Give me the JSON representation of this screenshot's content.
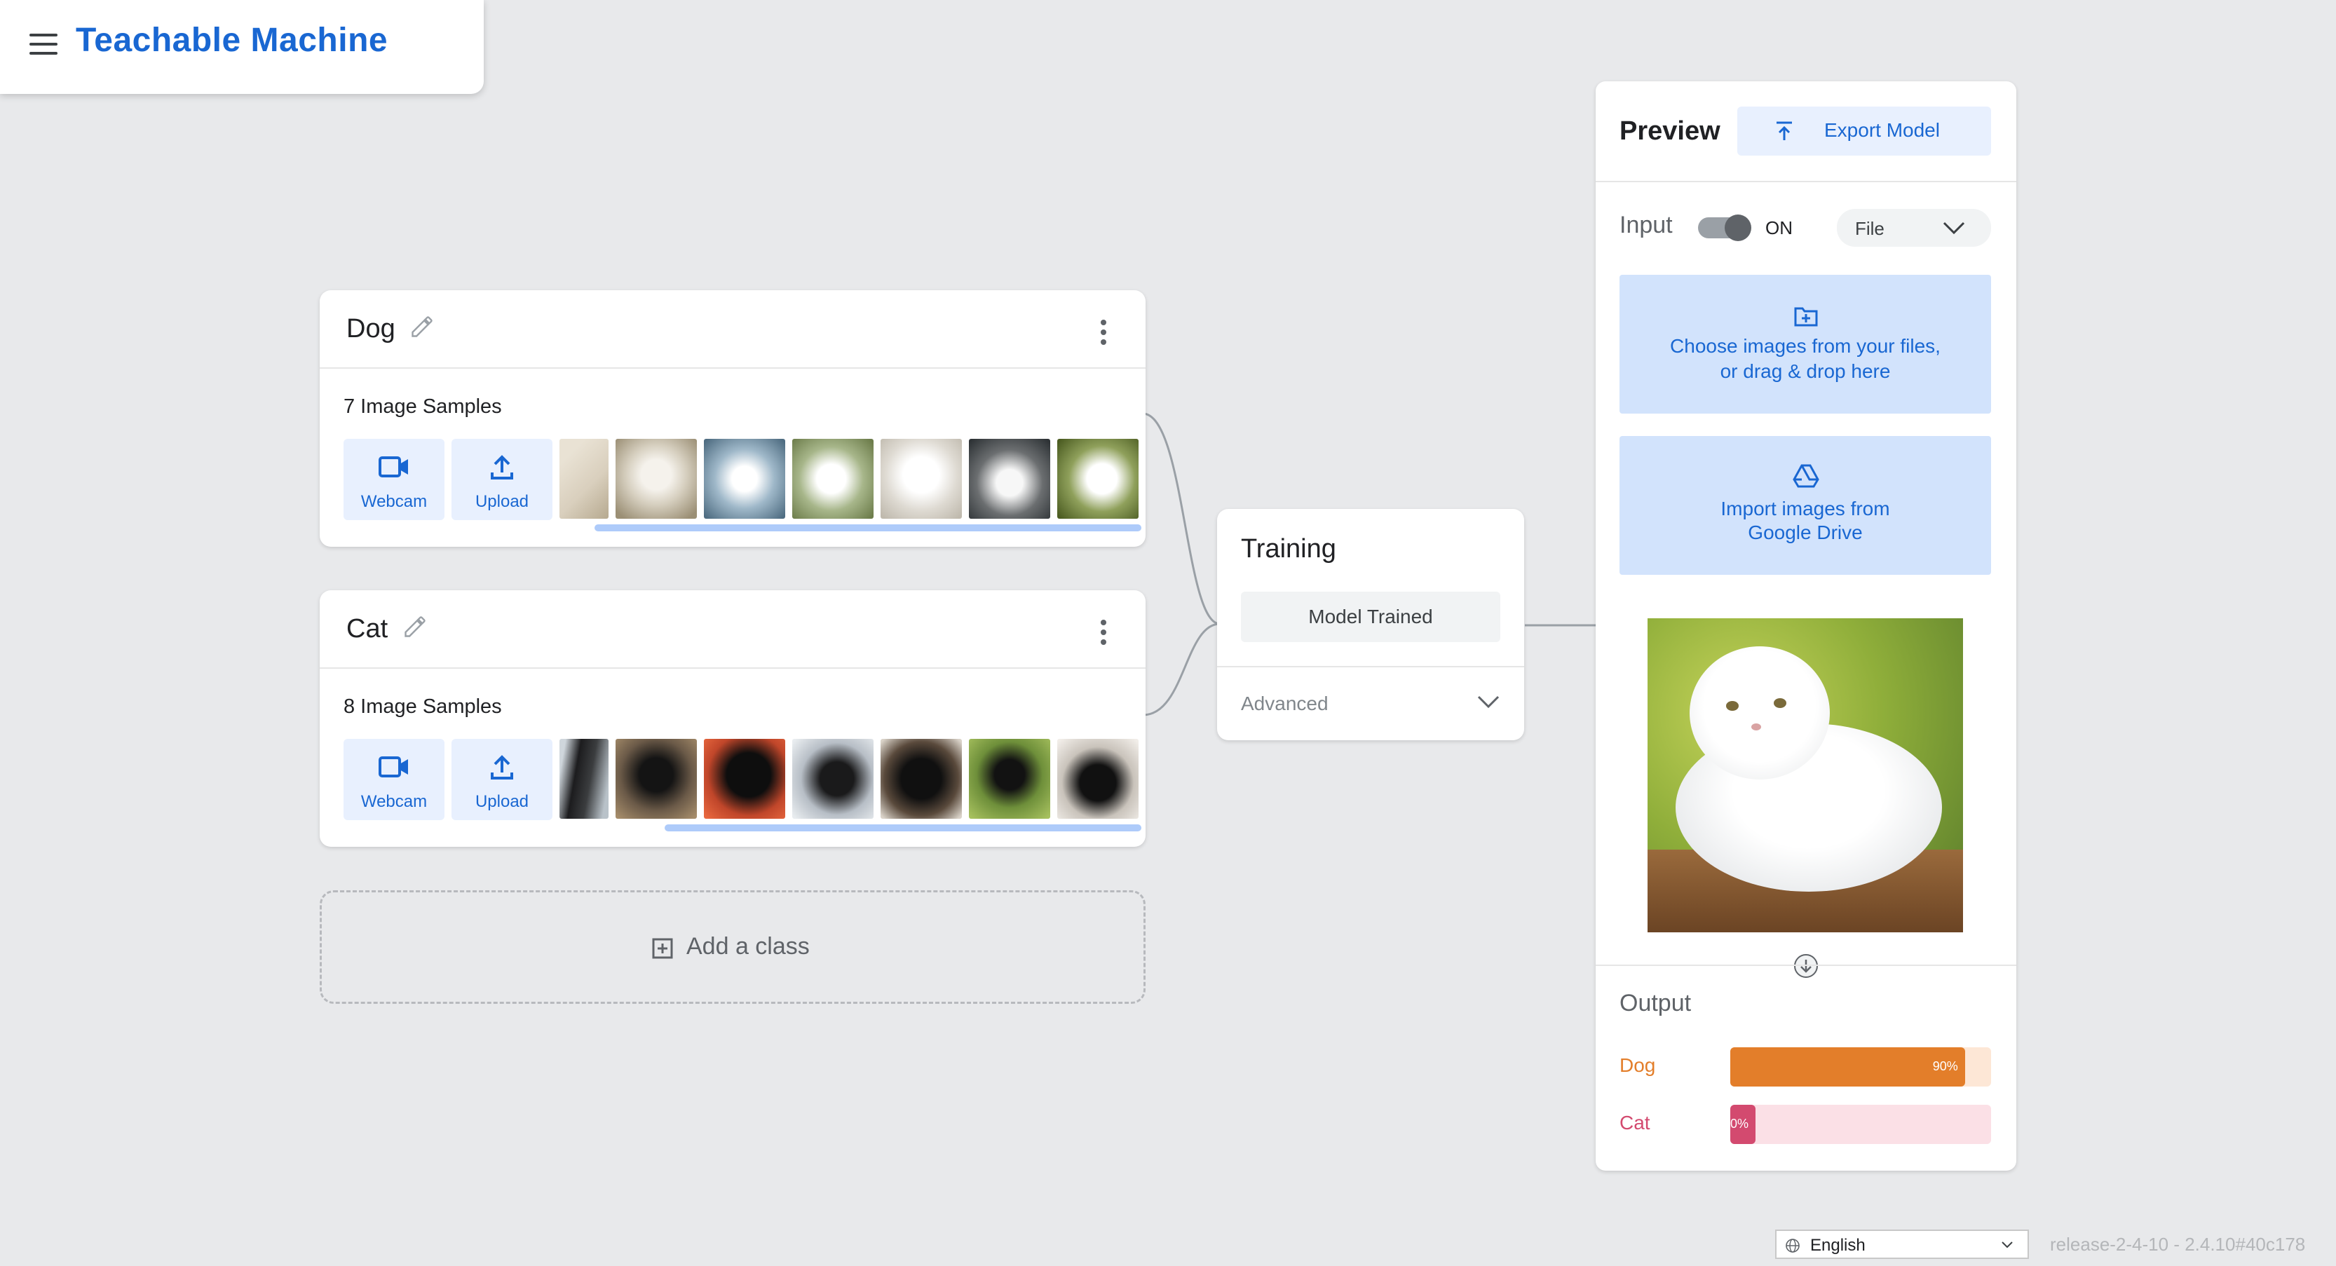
{
  "header": {
    "title": "Teachable Machine"
  },
  "classes": [
    {
      "name": "Dog",
      "samples_label": "7 Image Samples",
      "webcam_label": "Webcam",
      "upload_label": "Upload"
    },
    {
      "name": "Cat",
      "samples_label": "8 Image Samples",
      "webcam_label": "Webcam",
      "upload_label": "Upload"
    }
  ],
  "add_class_label": "Add a class",
  "training": {
    "title": "Training",
    "button_label": "Model Trained",
    "advanced_label": "Advanced"
  },
  "preview": {
    "title": "Preview",
    "export_label": "Export Model",
    "input_label": "Input",
    "toggle_state": "ON",
    "source_select": "File",
    "choose_files_line1": "Choose images from your files,",
    "choose_files_line2": "or drag & drop here",
    "drive_line1": "Import images from",
    "drive_line2": "Google Drive",
    "output_label": "Output",
    "outputs": [
      {
        "label": "Dog",
        "percent_text": "90%",
        "value": 90,
        "color": "#e37e2a",
        "track": "#fde7d6"
      },
      {
        "label": "Cat",
        "percent_text": "0%",
        "value": 10,
        "color": "#d34a6f",
        "track": "#fbe0e6"
      }
    ]
  },
  "footer": {
    "language": "English",
    "release": "release-2-4-10 - 2.4.10#40c178"
  },
  "colors": {
    "accent": "#1967d2",
    "background": "#e8e9eb"
  }
}
